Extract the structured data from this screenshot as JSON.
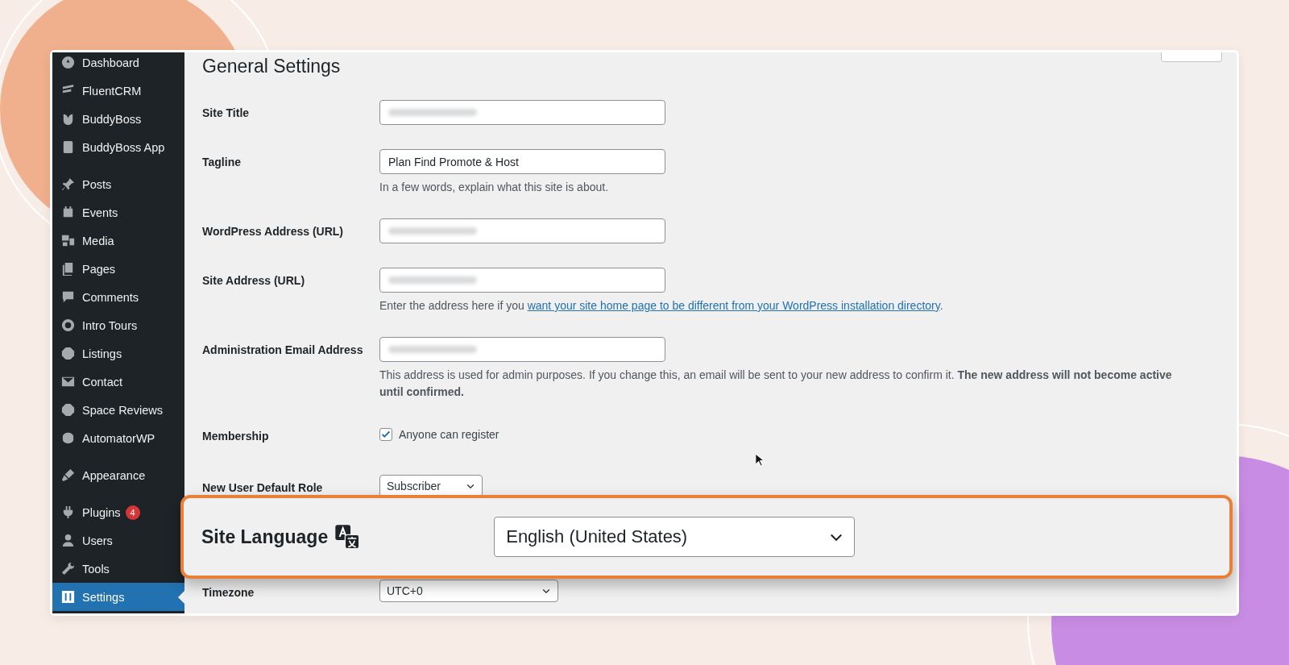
{
  "sidebar": {
    "groups": [
      [
        {
          "label": "Dashboard",
          "selected": false
        },
        {
          "label": "FluentCRM",
          "selected": false
        },
        {
          "label": "BuddyBoss",
          "selected": false
        },
        {
          "label": "BuddyBoss App",
          "selected": false
        }
      ],
      [
        {
          "label": "Posts",
          "selected": false
        },
        {
          "label": "Events",
          "selected": false
        },
        {
          "label": "Media",
          "selected": false
        },
        {
          "label": "Pages",
          "selected": false
        },
        {
          "label": "Comments",
          "selected": false
        },
        {
          "label": "Intro Tours",
          "selected": false
        },
        {
          "label": "Listings",
          "selected": false
        },
        {
          "label": "Contact",
          "selected": false
        },
        {
          "label": "Space Reviews",
          "selected": false
        },
        {
          "label": "AutomatorWP",
          "selected": false
        }
      ],
      [
        {
          "label": "Appearance",
          "selected": false
        }
      ],
      [
        {
          "label": "Plugins",
          "selected": false,
          "badge": "4"
        },
        {
          "label": "Users",
          "selected": false
        },
        {
          "label": "Tools",
          "selected": false
        },
        {
          "label": "Settings",
          "selected": true
        }
      ]
    ]
  },
  "page": {
    "title": "General Settings"
  },
  "settings": [
    {
      "kind": "text",
      "label": "Site Title",
      "blurred": true
    },
    {
      "kind": "text",
      "label": "Tagline",
      "value": "Plan Find Promote & Host",
      "hint": "In a few words, explain what this site is about."
    },
    {
      "kind": "text",
      "label": "WordPress Address (URL)",
      "blurred": true
    },
    {
      "kind": "text",
      "label": "Site Address (URL)",
      "blurred": true,
      "hint": "Enter the address here if you ",
      "hint_link": "want your site home page to be different from your WordPress installation directory",
      "hint_after": "."
    },
    {
      "kind": "text",
      "label": "Administration Email Address",
      "blurred": true,
      "hint": "This address is used for admin purposes. If you change this, an email will be sent to your new address to confirm it. **The new address will not become active until confirmed.**"
    },
    {
      "kind": "checkbox",
      "label": "Membership",
      "checked": true,
      "option": "Anyone can register"
    },
    {
      "kind": "select",
      "label": "New User Default Role",
      "value": "Subscriber"
    },
    {
      "kind": "select",
      "label": "Timezone",
      "value": "UTC+0"
    }
  ],
  "highlight": {
    "label": "Site Language",
    "value": "English (United States)"
  }
}
